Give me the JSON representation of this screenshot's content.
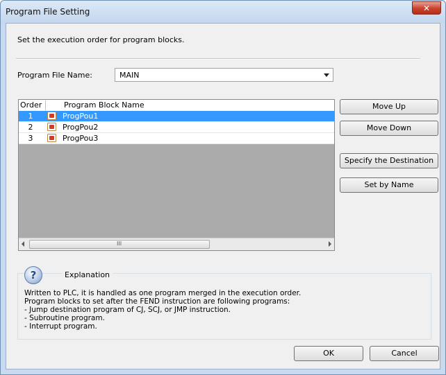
{
  "window": {
    "title": "Program File Setting"
  },
  "description": "Set the execution order for program blocks.",
  "program_file": {
    "label": "Program File Name:",
    "value": "MAIN"
  },
  "list": {
    "headers": [
      "Order",
      "Program Block Name"
    ],
    "rows": [
      {
        "order": "1",
        "name": "ProgPou1",
        "selected": true
      },
      {
        "order": "2",
        "name": "ProgPou2",
        "selected": false
      },
      {
        "order": "3",
        "name": "ProgPou3",
        "selected": false
      }
    ],
    "scroll_grip": "III"
  },
  "buttons": {
    "move_up": "Move Up",
    "move_down": "Move Down",
    "specify_destination": "Specify the Destination",
    "set_by_name": "Set by Name",
    "ok": "OK",
    "cancel": "Cancel"
  },
  "explanation": {
    "title": "Explanation",
    "lines": [
      "Written to PLC, it is handled as one program merged in the execution order.",
      "Program blocks to set after the FEND instruction are following programs:",
      "- Jump destination program of CJ, SCJ, or JMP instruction.",
      "- Subroutine program.",
      "- Interrupt program."
    ]
  },
  "icons": {
    "close": "close-icon",
    "dropdown": "chevron-down-icon",
    "program_block": "program-block-icon",
    "explanation": "question-icon"
  },
  "colors": {
    "selection": "#3399ff",
    "title_bar": "#c9daee"
  }
}
